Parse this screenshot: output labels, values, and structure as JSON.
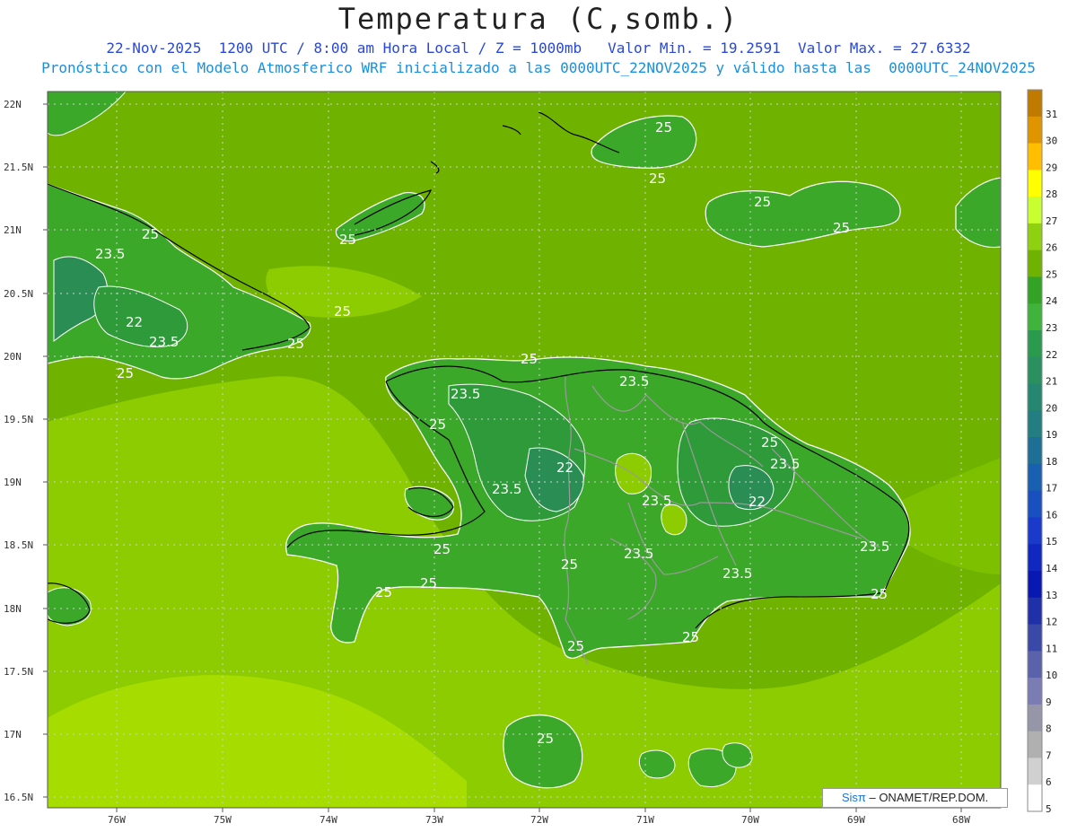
{
  "title": "Temperatura (C,somb.)",
  "subtitle1": "22-Nov-2025  1200 UTC / 8:00 am Hora Local / Z = 1000mb   Valor Min. = 19.2591  Valor Max. = 27.6332",
  "subtitle2": "Pronóstico con el Modelo Atmosferico WRF inicializado a las 0000UTC_22NOV2025 y válido hasta las  0000UTC_24NOV2025",
  "credit": {
    "brand": "Sisπ",
    "text": " – ONAMET/REP.DOM."
  },
  "map": {
    "lat_labels": [
      "22N",
      "21.5N",
      "21N",
      "20.5N",
      "20N",
      "19.5N",
      "19N",
      "18.5N",
      "18N",
      "17.5N",
      "17N",
      "16.5N"
    ],
    "lon_labels": [
      "76W",
      "75W",
      "74W",
      "73W",
      "72W",
      "71W",
      "70W",
      "69W",
      "68W"
    ],
    "contour_labels": [
      "25",
      "25",
      "25",
      "25",
      "25",
      "25",
      "25",
      "23.5",
      "22",
      "23.5",
      "25",
      "25",
      "25",
      "23.5",
      "25",
      "22",
      "23.5",
      "23.5",
      "23.5",
      "25",
      "25",
      "25",
      "23.5",
      "25",
      "22",
      "23.5",
      "23.5",
      "23.5",
      "25",
      "25",
      "25",
      "25"
    ],
    "colors": {
      "ocean": "#6fb300",
      "warm_sea": "#8ccc00",
      "warmer_sea": "#a6dc00",
      "land_mid": "#3ba82a",
      "land_cool": "#2f9a3a",
      "land_cooler": "#2a8e54",
      "contour": "#ffffff",
      "coast": "#000000",
      "borders": "#9a9a9a"
    }
  },
  "colorbar": {
    "levels": [
      "31",
      "30",
      "29",
      "28",
      "27",
      "26",
      "25",
      "24",
      "23",
      "22",
      "21",
      "20",
      "19",
      "18",
      "17",
      "16",
      "15",
      "14",
      "13",
      "12",
      "11",
      "10",
      "9",
      "8",
      "7",
      "6",
      "5"
    ],
    "colors": [
      "#c07a00",
      "#e09400",
      "#ffbf00",
      "#ffff00",
      "#c8ff30",
      "#8fd010",
      "#6fb300",
      "#33a325",
      "#3fb33b",
      "#2a9a4e",
      "#2a9060",
      "#258770",
      "#227e80",
      "#1e6f95",
      "#1a60b0",
      "#1a4fc0",
      "#1a3acc",
      "#1028c0",
      "#0818b0",
      "#2030a8",
      "#3a48a8",
      "#5a62ac",
      "#7c7cb4",
      "#9696a8",
      "#b0b0b0",
      "#d0d0d0",
      "#ffffff"
    ]
  }
}
